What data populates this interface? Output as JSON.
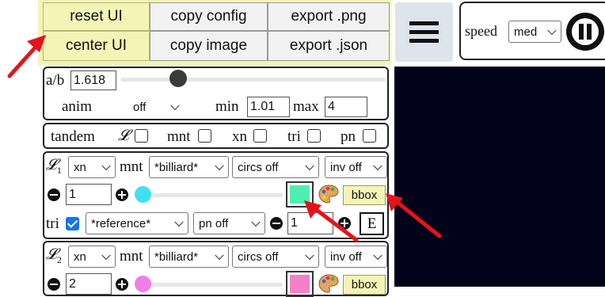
{
  "top_buttons": {
    "reset": "reset UI",
    "center": "center UI",
    "copy_config": "copy config",
    "copy_image": "copy image",
    "export_png": "export .png",
    "export_json": "export .json"
  },
  "speed": {
    "label": "speed",
    "value": "med"
  },
  "ratio": {
    "label": "a/b",
    "value": "1.618",
    "slider_position": 0.26,
    "anim_label": "anim",
    "anim_value": "off",
    "min_label": "min",
    "min_value": "1.01",
    "max_label": "max",
    "max_value": "4"
  },
  "tandem": {
    "label": "tandem",
    "script_l": "𝓛",
    "mnt": "mnt",
    "xn": "xn",
    "tri": "tri",
    "pn": "pn"
  },
  "l1": {
    "script": "𝓛",
    "sub": "1",
    "type_value": "xn",
    "mnt_label": "mnt",
    "mnt_value": "*billiard*",
    "circs_value": "circs off",
    "inv_value": "inv off",
    "count": "1",
    "color": "#4ef0b0",
    "dot_color": "#40e0f0",
    "bbox": "bbox",
    "tri_label": "tri",
    "tri_checked": true,
    "ref_value": "*reference*",
    "pn_value": "pn off",
    "tri_count": "1",
    "e_label": "E"
  },
  "l2": {
    "script": "𝓛",
    "sub": "2",
    "type_value": "xn",
    "mnt_label": "mnt",
    "mnt_value": "*billiard*",
    "circs_value": "circs off",
    "inv_value": "inv off",
    "count": "2",
    "color": "#f580c8",
    "dot_color": "#f07ee8",
    "bbox": "bbox"
  },
  "colors": {
    "canvas": "#02021a",
    "highlight": "#f3f4b6",
    "annotation_arrow": "#e5141b"
  },
  "icons": [
    "menu-icon",
    "pause-icon",
    "palette-icon",
    "minus-circle-icon",
    "plus-circle-icon",
    "chevron-down-icon"
  ]
}
